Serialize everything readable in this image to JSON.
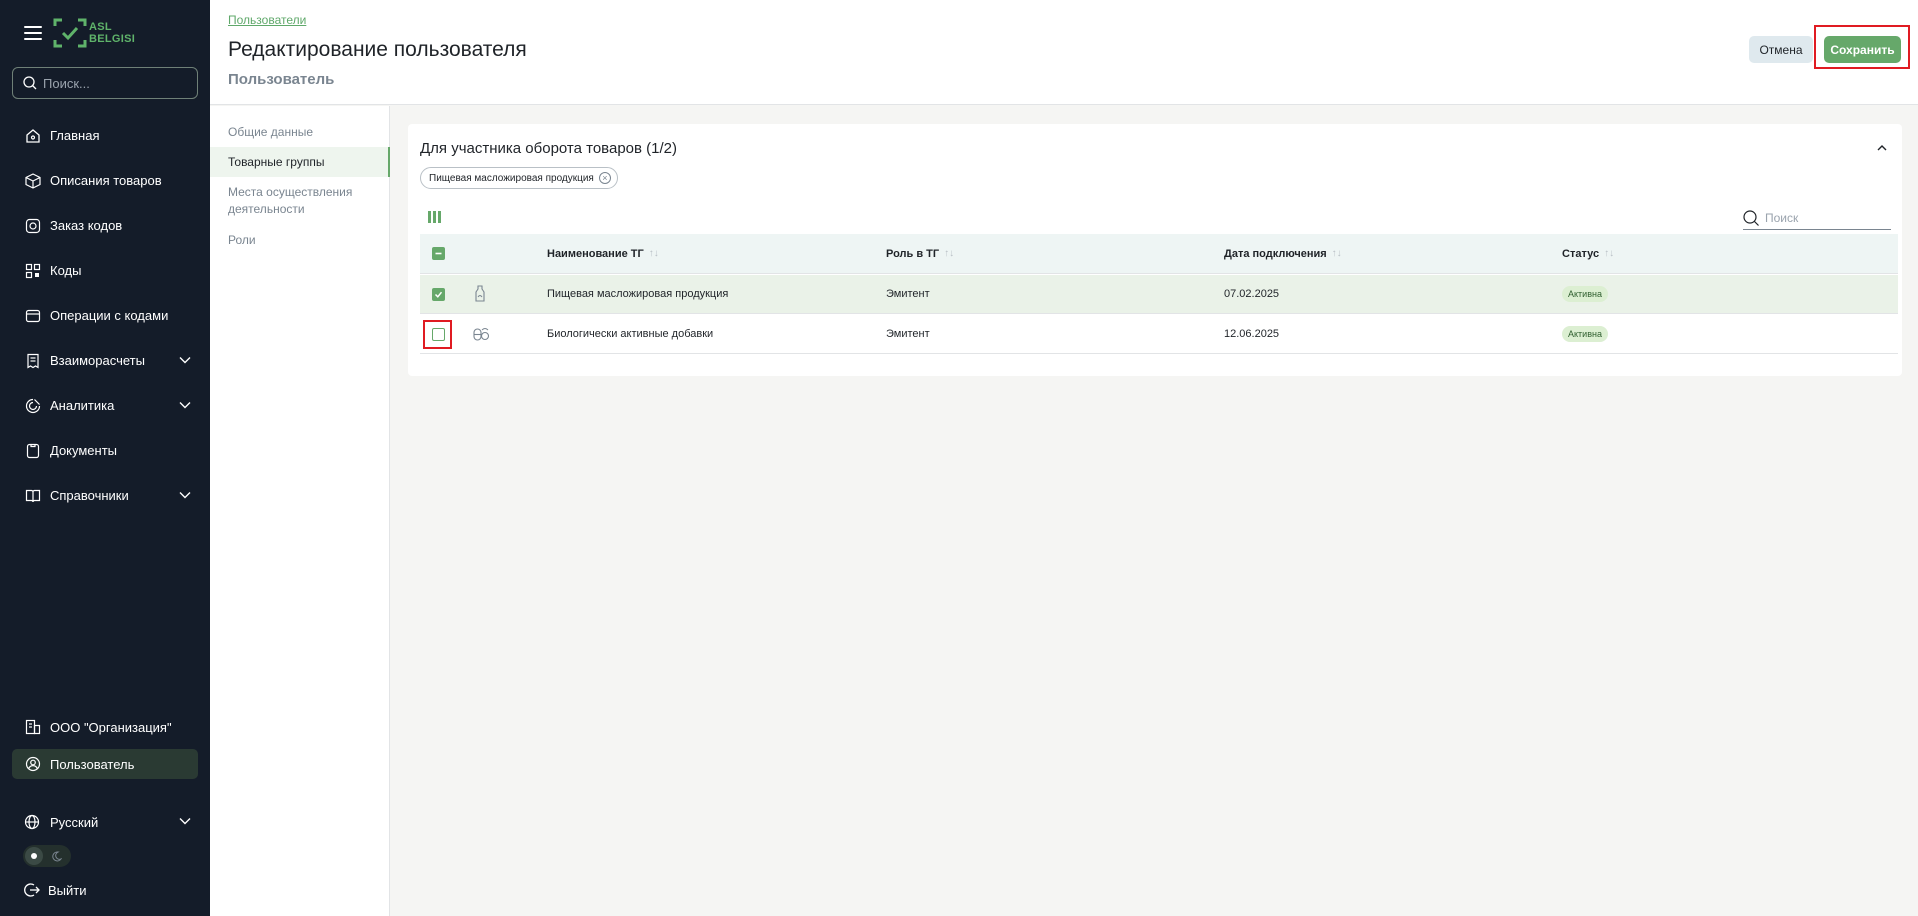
{
  "sidebar": {
    "logo_line1": "ASL",
    "logo_line2": "BELGISI",
    "search_placeholder": "Поиск...",
    "items": [
      {
        "label": "Главная",
        "icon": "home-icon"
      },
      {
        "label": "Описания товаров",
        "icon": "box-icon"
      },
      {
        "label": "Заказ кодов",
        "icon": "code-order-icon"
      },
      {
        "label": "Коды",
        "icon": "qr-icon"
      },
      {
        "label": "Операции с кодами",
        "icon": "operations-icon"
      },
      {
        "label": "Взаиморасчеты",
        "icon": "receipt-icon",
        "expandable": true
      },
      {
        "label": "Аналитика",
        "icon": "analytics-icon",
        "expandable": true
      },
      {
        "label": "Документы",
        "icon": "document-icon"
      },
      {
        "label": "Справочники",
        "icon": "book-icon",
        "expandable": true
      }
    ],
    "organization": "ООО \"Организация\"",
    "user": "Пользователь",
    "language": "Русский",
    "logout": "Выйти"
  },
  "header": {
    "breadcrumb": "Пользователи",
    "title": "Редактирование пользователя",
    "subtitle": "Пользователь",
    "cancel_label": "Отмена",
    "save_label": "Сохранить"
  },
  "subnav": {
    "items": [
      "Общие данные",
      "Товарные группы",
      "Места осуществления деятельности",
      "Роли"
    ],
    "active": "Товарные группы"
  },
  "card": {
    "title": "Для участника оборота товаров (1/2)",
    "chip": "Пищевая масложировая продукция",
    "search_placeholder": "Поиск",
    "columns": [
      "Наименование ТГ",
      "Роль в ТГ",
      "Дата подключения",
      "Статус"
    ],
    "rows": [
      {
        "name": "Пищевая масложировая продукция",
        "role": "Эмитент",
        "date": "07.02.2025",
        "status": "Активна",
        "checked": true,
        "icon": "oil-bottle-icon"
      },
      {
        "name": "Биологически активные добавки",
        "role": "Эмитент",
        "date": "12.06.2025",
        "status": "Активна",
        "checked": false,
        "icon": "supplement-icon"
      }
    ]
  },
  "colors": {
    "sidebar_bg": "#141c29",
    "accent_green": "#66a86a",
    "highlight_red": "#e01b22"
  }
}
